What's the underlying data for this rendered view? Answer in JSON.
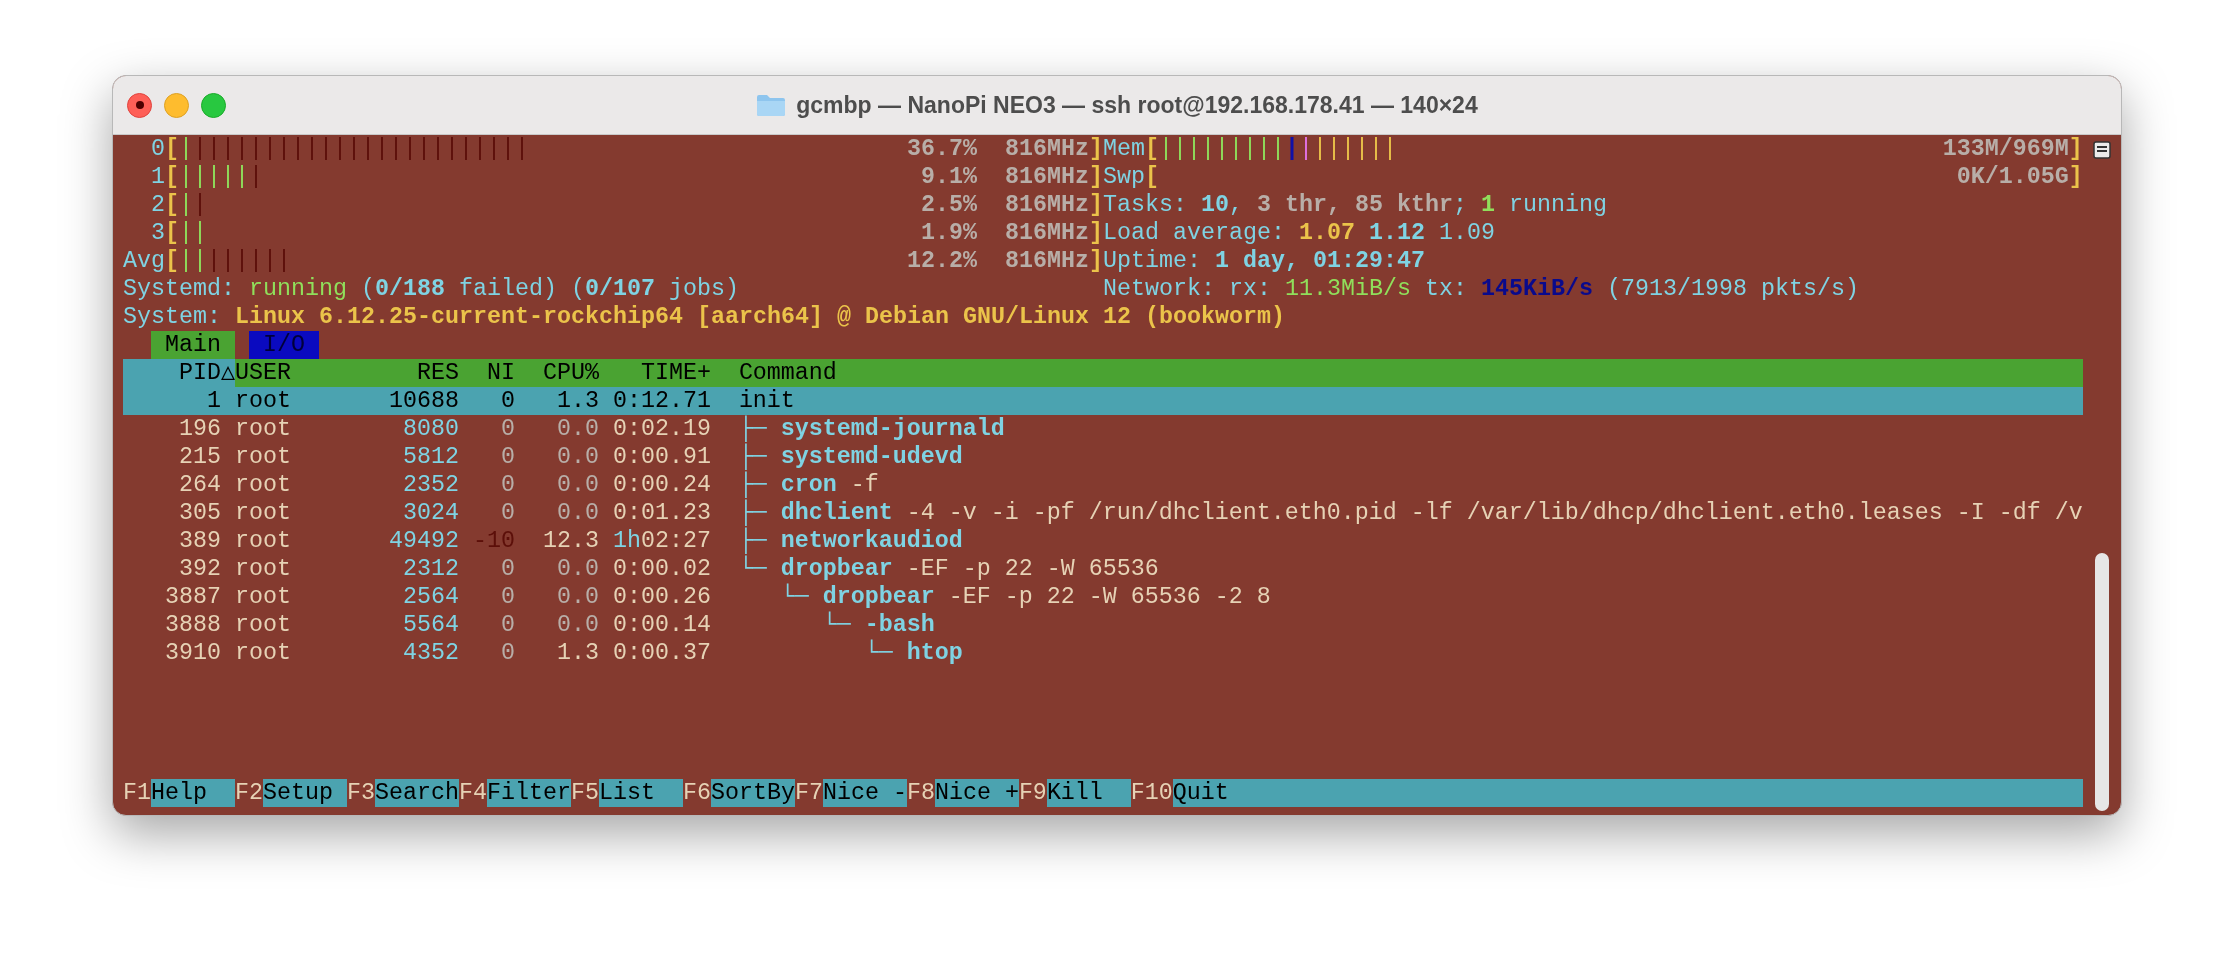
{
  "window": {
    "title": "gcmbp — NanoPi NEO3 — ssh root@192.168.178.41 — 140×24"
  },
  "cpu_meters": [
    {
      "label": "0",
      "left": "[",
      "right": "]",
      "segments": [
        {
          "kind": "user",
          "text": "|"
        },
        {
          "kind": "system",
          "text": "||||||||||||||||||||||||"
        }
      ],
      "percent": "36.7%",
      "freq": "816MHz"
    },
    {
      "label": "1",
      "left": "[",
      "right": "]",
      "segments": [
        {
          "kind": "user",
          "text": "|||||"
        },
        {
          "kind": "system",
          "text": "|"
        }
      ],
      "percent": "9.1%",
      "freq": "816MHz"
    },
    {
      "label": "2",
      "left": "[",
      "right": "]",
      "segments": [
        {
          "kind": "user",
          "text": "|"
        },
        {
          "kind": "system",
          "text": "|"
        }
      ],
      "percent": "2.5%",
      "freq": "816MHz"
    },
    {
      "label": "3",
      "left": "[",
      "right": "]",
      "segments": [
        {
          "kind": "user",
          "text": "||"
        }
      ],
      "percent": "1.9%",
      "freq": "816MHz"
    },
    {
      "label": "Avg",
      "left": "[",
      "right": "]",
      "segments": [
        {
          "kind": "user",
          "text": "||"
        },
        {
          "kind": "system",
          "text": "||||||"
        }
      ],
      "percent": "12.2%",
      "freq": "816MHz"
    }
  ],
  "memory_meters": [
    {
      "label": "Mem",
      "left": "[",
      "right": "]",
      "segments": [
        {
          "kind": "used",
          "text": "|||||||||"
        },
        {
          "kind": "buffers",
          "text": "|"
        },
        {
          "kind": "shared",
          "text": "|"
        },
        {
          "kind": "cache",
          "text": "||||||"
        }
      ],
      "reading": "133M/969M"
    },
    {
      "label": "Swp",
      "left": "[",
      "right": "]",
      "reading": "0K/1.05G"
    }
  ],
  "tasks": {
    "runs": [
      {
        "text": "Tasks: ",
        "kind": "label"
      },
      {
        "text": "10",
        "kind": "value"
      },
      {
        "text": ", ",
        "kind": "label"
      },
      {
        "text": "3 thr, 85 kthr",
        "kind": "dim"
      },
      {
        "text": "; ",
        "kind": "label"
      },
      {
        "text": "1",
        "kind": "good_bold"
      },
      {
        "text": " running",
        "kind": "label"
      }
    ]
  },
  "load_average": {
    "runs": [
      {
        "text": "Load average: ",
        "kind": "label"
      },
      {
        "text": "1.07",
        "kind": "warn"
      },
      {
        "text": " 1.12",
        "kind": "value"
      },
      {
        "text": " 1.09",
        "kind": "label"
      }
    ]
  },
  "uptime": {
    "runs": [
      {
        "text": "Uptime: ",
        "kind": "label"
      },
      {
        "text": "1 day, 01:29:47",
        "kind": "value"
      }
    ]
  },
  "systemd": {
    "runs": [
      {
        "text": "Systemd: ",
        "kind": "label"
      },
      {
        "text": "running",
        "kind": "good"
      },
      {
        "text": " (",
        "kind": "label"
      },
      {
        "text": "0/188",
        "kind": "value"
      },
      {
        "text": " failed) (",
        "kind": "label"
      },
      {
        "text": "0/107",
        "kind": "value"
      },
      {
        "text": " jobs)",
        "kind": "label"
      }
    ]
  },
  "network": {
    "runs": [
      {
        "text": "Network: rx: ",
        "kind": "label"
      },
      {
        "text": "11.3MiB/s",
        "kind": "good"
      },
      {
        "text": " tx: ",
        "kind": "label"
      },
      {
        "text": "145KiB/s",
        "kind": "shadow"
      },
      {
        "text": " (7913/1998 pkts/s)",
        "kind": "label"
      }
    ]
  },
  "system": {
    "runs": [
      {
        "text": "System: ",
        "kind": "label"
      },
      {
        "text": "Linux 6.12.25-current-rockchip64 [aarch64] @ Debian GNU/Linux 12 (bookworm)",
        "kind": "warn"
      }
    ]
  },
  "tabs": [
    {
      "label": "Main",
      "selected": true
    },
    {
      "label": "I/O",
      "selected": false
    }
  ],
  "columns": [
    {
      "label": "PID",
      "sorted": true,
      "sort_indicator": "△"
    },
    {
      "label": "USER",
      "sorted": false
    },
    {
      "label": "RES",
      "sorted": false
    },
    {
      "label": "NI",
      "sorted": false
    },
    {
      "label": "CPU%",
      "sorted": false
    },
    {
      "label": "TIME+",
      "sorted": false
    },
    {
      "label": "Command",
      "sorted": false
    }
  ],
  "processes": [
    {
      "pid": "1",
      "user": "root",
      "res": "10688",
      "ni": "0",
      "cpu": "1.3",
      "time": "0:12.71",
      "name": "init",
      "selected": true,
      "children": [
        {
          "pid": "196",
          "user": "root",
          "res": "8080",
          "ni": "0",
          "ni_raised": false,
          "cpu": "0.0",
          "cpu_active": false,
          "time": "0:02.19",
          "branch": "├─",
          "name": "systemd-journald",
          "selected": false
        },
        {
          "pid": "215",
          "user": "root",
          "res": "5812",
          "ni": "0",
          "ni_raised": false,
          "cpu": "0.0",
          "cpu_active": false,
          "time": "0:00.91",
          "branch": "├─",
          "name": "systemd-udevd",
          "selected": false
        },
        {
          "pid": "264",
          "user": "root",
          "res": "2352",
          "ni": "0",
          "ni_raised": false,
          "cpu": "0.0",
          "cpu_active": false,
          "time": "0:00.24",
          "branch": "├─",
          "name": "cron",
          "args": "-f",
          "selected": false
        },
        {
          "pid": "305",
          "user": "root",
          "res": "3024",
          "ni": "0",
          "ni_raised": false,
          "cpu": "0.0",
          "cpu_active": false,
          "time": "0:01.23",
          "branch": "├─",
          "name": "dhclient",
          "args": "-4 -v -i -pf /run/dhclient.eth0.pid -lf /var/lib/dhcp/dhclient.eth0.leases -I -df /v",
          "selected": false
        },
        {
          "pid": "389",
          "user": "root",
          "res": "49492",
          "ni": "-10",
          "ni_raised": true,
          "cpu": "12.3",
          "cpu_active": true,
          "time_hours": "1h",
          "time": "02:27",
          "branch": "├─",
          "name": "networkaudiod",
          "selected": false
        },
        {
          "pid": "392",
          "user": "root",
          "res": "2312",
          "ni": "0",
          "ni_raised": false,
          "cpu": "0.0",
          "cpu_active": false,
          "time": "0:00.02",
          "branch": "└─",
          "name": "dropbear",
          "args": "-EF -p 22 -W 65536",
          "selected": false,
          "children": [
            {
              "pid": "3887",
              "user": "root",
              "res": "2564",
              "ni": "0",
              "ni_raised": false,
              "cpu": "0.0",
              "cpu_active": false,
              "time": "0:00.26",
              "branch": "└─",
              "name": "dropbear",
              "args": "-EF -p 22 -W 65536 -2 8",
              "selected": false,
              "children": [
                {
                  "pid": "3888",
                  "user": "root",
                  "res": "5564",
                  "ni": "0",
                  "ni_raised": false,
                  "cpu": "0.0",
                  "cpu_active": false,
                  "time": "0:00.14",
                  "branch": "└─",
                  "name": "-bash",
                  "selected": false,
                  "children": [
                    {
                      "pid": "3910",
                      "user": "root",
                      "res": "4352",
                      "ni": "0",
                      "ni_raised": false,
                      "cpu": "1.3",
                      "cpu_active": true,
                      "time": "0:00.37",
                      "branch": "└─",
                      "name": "htop",
                      "selected": false
                    }
                  ]
                }
              ]
            }
          ]
        }
      ]
    }
  ],
  "function_keys": [
    {
      "key": "F1",
      "label": "Help"
    },
    {
      "key": "F2",
      "label": "Setup"
    },
    {
      "key": "F3",
      "label": "Search"
    },
    {
      "key": "F4",
      "label": "Filter"
    },
    {
      "key": "F5",
      "label": "List"
    },
    {
      "key": "F6",
      "label": "SortBy"
    },
    {
      "key": "F7",
      "label": "Nice -"
    },
    {
      "key": "F8",
      "label": "Nice +"
    },
    {
      "key": "F9",
      "label": "Kill"
    },
    {
      "key": "F10",
      "label": "Quit"
    }
  ]
}
